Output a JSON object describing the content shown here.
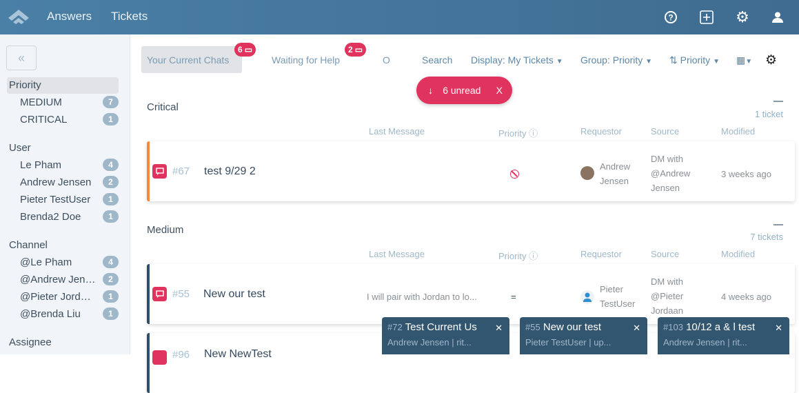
{
  "header": {
    "nav": [
      "Answers",
      "Tickets"
    ],
    "icons": [
      "help-icon",
      "add-icon",
      "gear-icon",
      "user-icon"
    ]
  },
  "sidebar": {
    "groups": [
      {
        "label": "Priority",
        "items": [
          {
            "label": "MEDIUM",
            "count": "7"
          },
          {
            "label": "CRITICAL",
            "count": "1"
          }
        ]
      },
      {
        "label": "User",
        "items": [
          {
            "label": "Le Pham",
            "count": "4"
          },
          {
            "label": "Andrew Jensen",
            "count": "2"
          },
          {
            "label": "Pieter TestUser",
            "count": "1"
          },
          {
            "label": "Brenda2 Doe",
            "count": "1"
          }
        ]
      },
      {
        "label": "Channel",
        "items": [
          {
            "label": "@Le Pham",
            "count": "4"
          },
          {
            "label": "@Andrew Jensen",
            "count": "2"
          },
          {
            "label": "@Pieter Jordaan",
            "count": "1"
          },
          {
            "label": "@Brenda Liu",
            "count": "1"
          }
        ]
      },
      {
        "label": "Assignee",
        "items": []
      }
    ]
  },
  "toolbar": {
    "tabs": [
      {
        "label": "Your Current Chats",
        "badge": "6"
      },
      {
        "label": "Waiting for Help",
        "badge": "2"
      },
      {
        "label": "O"
      }
    ],
    "search": "Search",
    "display": "Display: My Tickets",
    "group": "Group: Priority",
    "sort": "Priority"
  },
  "unread": {
    "label": "6 unread",
    "close": "X"
  },
  "columns": [
    "Last Message",
    "Priority",
    "Requestor",
    "Source",
    "Modified"
  ],
  "sections": [
    {
      "name": "Critical",
      "count": "1 ticket",
      "accent": "#f5883a",
      "tickets": [
        {
          "id": "#67",
          "title": "test 9/29 2",
          "last": "",
          "priority": "blocked",
          "requestor": [
            "Andrew",
            "Jensen"
          ],
          "source": [
            "DM with",
            "@Andrew",
            "Jensen"
          ],
          "modified": "3 weeks ago"
        }
      ]
    },
    {
      "name": "Medium",
      "count": "7 tickets",
      "accent": "#2f4e69",
      "tickets": [
        {
          "id": "#55",
          "title": "New our test",
          "last": "I will pair with Jordan to lo...",
          "priority": "=",
          "requestor": [
            "Pieter",
            "TestUser"
          ],
          "source": [
            "DM with",
            "@Pieter",
            "Jordaan"
          ],
          "modified": "4 weeks ago"
        },
        {
          "id": "#96",
          "title": "New NewTest"
        }
      ]
    }
  ],
  "popups": [
    {
      "id": "#72",
      "title": "Test Current Us",
      "sub": "Andrew Jensen | rit..."
    },
    {
      "id": "#55",
      "title": "New our test",
      "sub": "Pieter TestUser | up..."
    },
    {
      "id": "#103",
      "title": "10/12 a & l test",
      "sub": "Andrew Jensen | rit..."
    }
  ]
}
